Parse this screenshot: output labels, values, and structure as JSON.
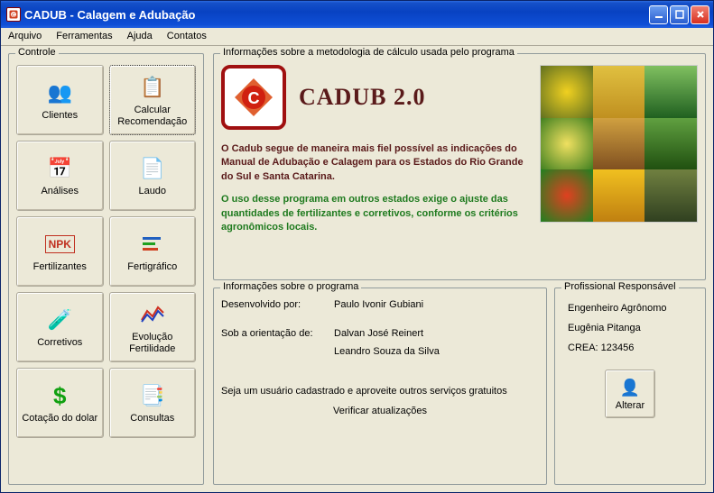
{
  "window": {
    "title": "CADUB - Calagem e Adubação"
  },
  "menu": {
    "arquivo": "Arquivo",
    "ferramentas": "Ferramentas",
    "ajuda": "Ajuda",
    "contatos": "Contatos"
  },
  "controle": {
    "title": "Controle",
    "buttons": {
      "clientes": "Clientes",
      "calcular": "Calcular Recomendação",
      "analises": "Análises",
      "laudo": "Laudo",
      "fertilizantes": "Fertilizantes",
      "fertigrafico": "Fertigráfico",
      "corretivos": "Corretivos",
      "evolucao": "Evolução Fertilidade",
      "cotacao": "Cotação do dolar",
      "consultas": "Consultas"
    }
  },
  "methodology": {
    "title": "Informações sobre a metodologia de cálculo usada pelo programa",
    "app_name": "CADUB 2.0",
    "text1": "O Cadub segue de maneira mais fiel possível as indicações do Manual de Adubação e Calagem para os Estados do Rio Grande do Sul e Santa Catarina.",
    "text2": "O uso desse programa em outros estados exige o ajuste das quantidades de fertilizantes e corretivos, conforme os critérios agronômicos locais."
  },
  "program_info": {
    "title": "Informações sobre o programa",
    "dev_label": "Desenvolvido por:",
    "dev_value": "Paulo Ivonir Gubiani",
    "orient_label": "Sob a orientação de:",
    "orient_value1": "Dalvan José Reinert",
    "orient_value2": "Leandro Souza da Silva",
    "footer": "Seja um usuário cadastrado e aproveite outros serviços gratuitos",
    "verify": "Verificar atualizações"
  },
  "professional": {
    "title": "Profissional Responsável",
    "role": "Engenheiro Agrônomo",
    "name": "Eugênia Pitanga",
    "crea": "CREA: 123456",
    "alterar": "Alterar"
  }
}
